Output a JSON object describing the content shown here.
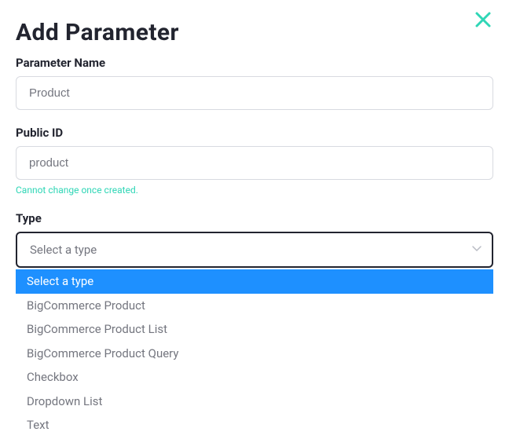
{
  "dialog": {
    "title": "Add Parameter"
  },
  "fields": {
    "name": {
      "label": "Parameter Name",
      "value": "Product"
    },
    "publicId": {
      "label": "Public ID",
      "value": "product",
      "hint": "Cannot change once created."
    },
    "type": {
      "label": "Type",
      "placeholder": "Select a type",
      "options": [
        "Select a type",
        "BigCommerce Product",
        "BigCommerce Product List",
        "BigCommerce Product Query",
        "Checkbox",
        "Dropdown List",
        "Text"
      ],
      "selectedIndex": 0
    }
  },
  "colors": {
    "accent": "#2fd6b6",
    "highlight": "#1e90ff"
  }
}
